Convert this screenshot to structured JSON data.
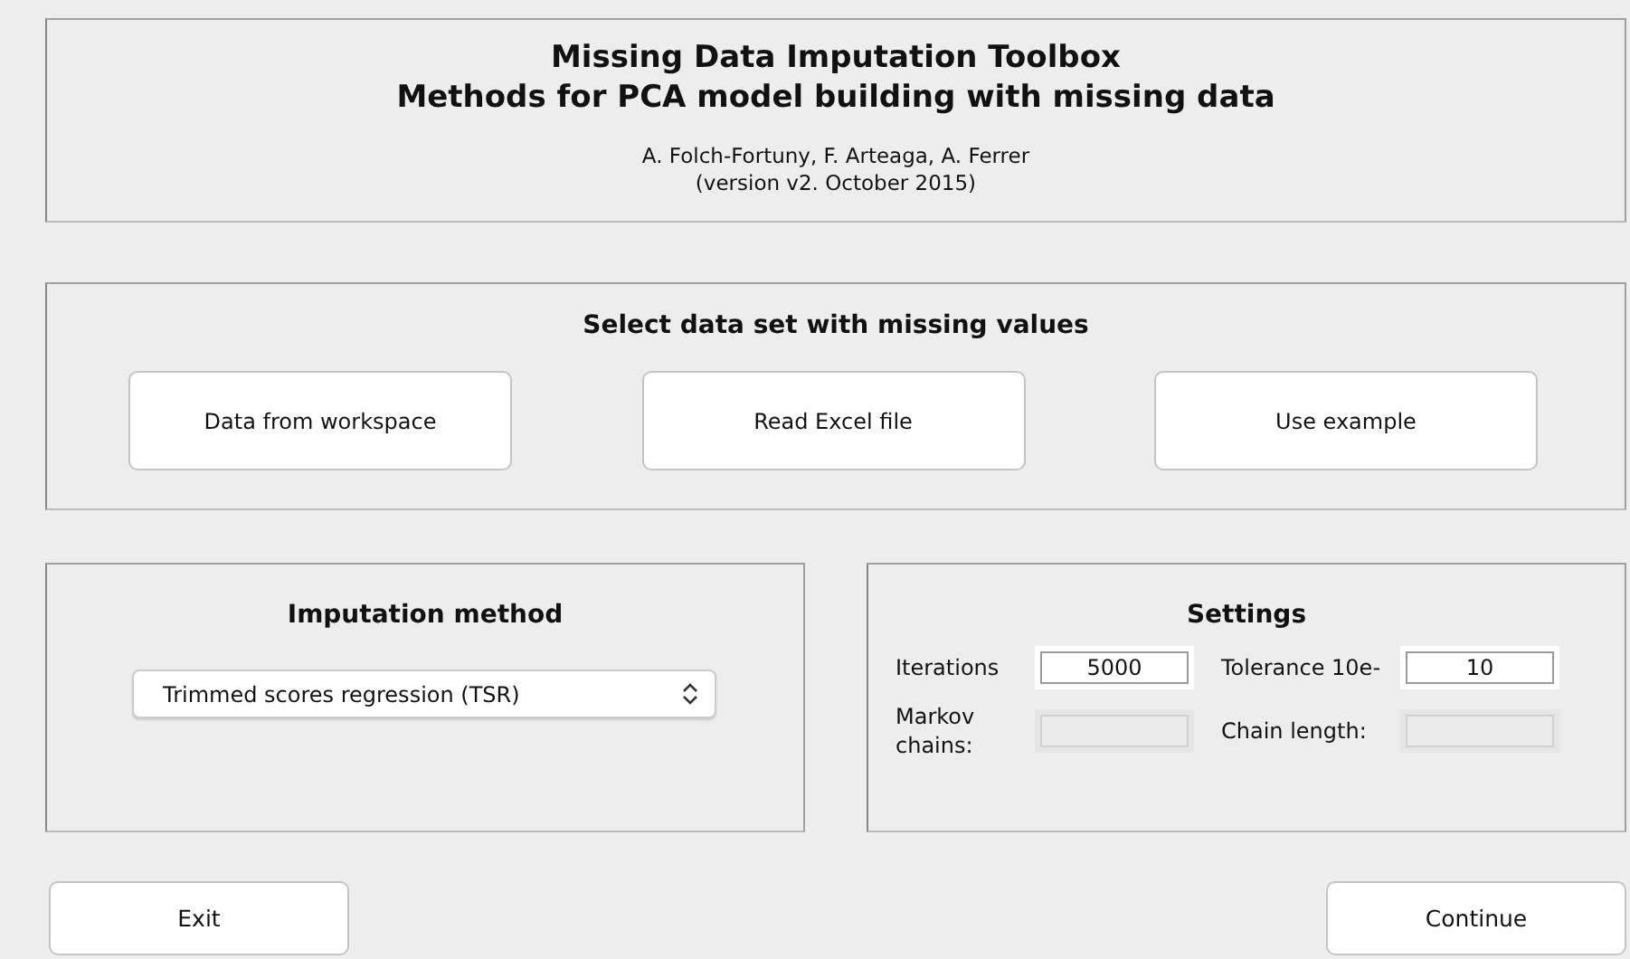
{
  "header": {
    "title_lines": [
      "Missing Data Imputation Toolbox",
      "Methods for PCA model building with missing data"
    ],
    "authors": "A. Folch-Fortuny, F. Arteaga, A. Ferrer",
    "version": "(version v2. October 2015)"
  },
  "data_source": {
    "title": "Select data set with missing values",
    "buttons": [
      "Data from workspace",
      "Read Excel file",
      "Use example"
    ]
  },
  "imputation": {
    "title": "Imputation method",
    "selected_method": "Trimmed scores regression (TSR)"
  },
  "settings": {
    "title": "Settings",
    "fields": [
      {
        "label": "Iterations",
        "value": "5000",
        "disabled": false
      },
      {
        "label": "Tolerance 10e-",
        "value": "10",
        "disabled": false
      },
      {
        "label": "Markov chains:",
        "disabled": true
      },
      {
        "label": "Chain length:",
        "disabled": true
      }
    ]
  },
  "buttons": [
    {
      "label": "Exit"
    },
    {
      "label": "Continue"
    }
  ]
}
